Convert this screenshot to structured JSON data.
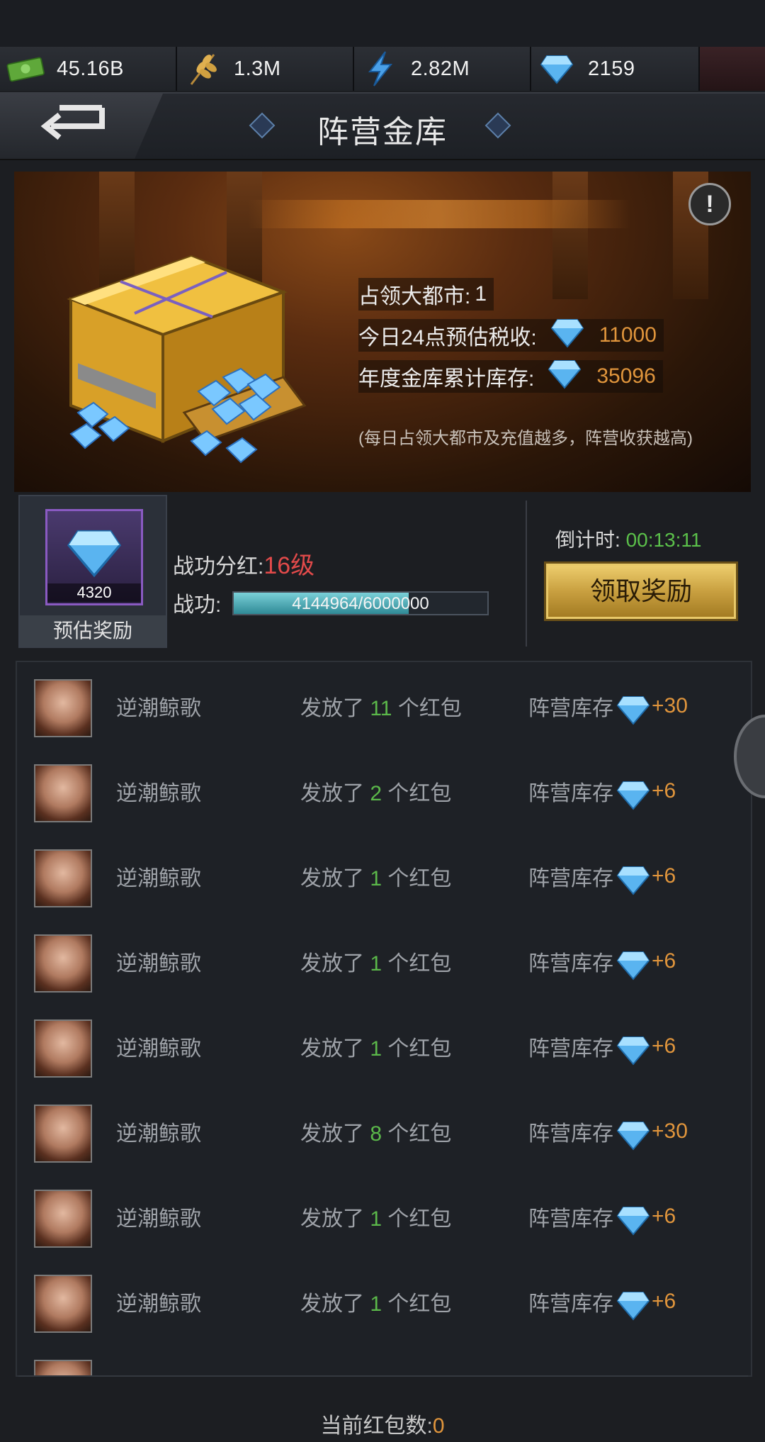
{
  "resources": [
    {
      "icon": "cash-icon",
      "value": "45.16B"
    },
    {
      "icon": "wheat-icon",
      "value": "1.3M"
    },
    {
      "icon": "lightning-icon",
      "value": "2.82M"
    },
    {
      "icon": "diamond-icon",
      "value": "2159"
    }
  ],
  "header": {
    "title": "阵营金库"
  },
  "treasury": {
    "cities_label": "占领大都市:",
    "cities_value": "1",
    "tax_label": "今日24点预估税收:",
    "tax_value": "11000",
    "stock_label": "年度金库累计库存:",
    "stock_value": "35096",
    "note": "(每日占领大都市及充值越多，阵营收获越高)"
  },
  "reward": {
    "gem_count": "4320",
    "label": "预估奖励",
    "dividend_label": "战功分红:",
    "dividend_level": "16级",
    "merit_label": "战功:",
    "merit_progress_text": "4144964/6000000",
    "merit_fraction": 0.69,
    "countdown_label": "倒计时:",
    "countdown_value": "00:13:11",
    "claim_label": "领取奖励"
  },
  "log": [
    {
      "name": "逆潮鲸歌",
      "pre": "发放了",
      "count": "11",
      "post": "个红包",
      "stock_label": "阵营库存",
      "amount": "+30"
    },
    {
      "name": "逆潮鲸歌",
      "pre": "发放了",
      "count": "2",
      "post": "个红包",
      "stock_label": "阵营库存",
      "amount": "+6"
    },
    {
      "name": "逆潮鲸歌",
      "pre": "发放了",
      "count": "1",
      "post": "个红包",
      "stock_label": "阵营库存",
      "amount": "+6"
    },
    {
      "name": "逆潮鲸歌",
      "pre": "发放了",
      "count": "1",
      "post": "个红包",
      "stock_label": "阵营库存",
      "amount": "+6"
    },
    {
      "name": "逆潮鲸歌",
      "pre": "发放了",
      "count": "1",
      "post": "个红包",
      "stock_label": "阵营库存",
      "amount": "+6"
    },
    {
      "name": "逆潮鲸歌",
      "pre": "发放了",
      "count": "8",
      "post": "个红包",
      "stock_label": "阵营库存",
      "amount": "+30"
    },
    {
      "name": "逆潮鲸歌",
      "pre": "发放了",
      "count": "1",
      "post": "个红包",
      "stock_label": "阵营库存",
      "amount": "+6"
    },
    {
      "name": "逆潮鲸歌",
      "pre": "发放了",
      "count": "1",
      "post": "个红包",
      "stock_label": "阵营库存",
      "amount": "+6"
    }
  ],
  "footer": {
    "label": "当前红包数:",
    "count": "0"
  },
  "colors": {
    "accent_orange": "#e0953c",
    "accent_green": "#5bb84a",
    "level_red": "#e14a4a",
    "gold_button": "#c9a040"
  }
}
